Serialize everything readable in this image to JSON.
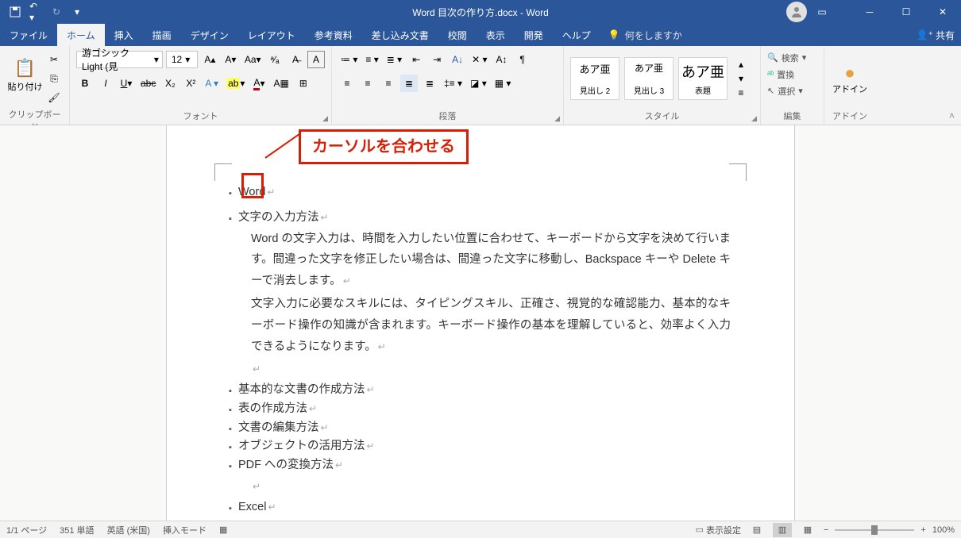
{
  "title": "Word  目次の作り方.docx  -  Word",
  "menutabs": [
    "ファイル",
    "ホーム",
    "挿入",
    "描画",
    "デザイン",
    "レイアウト",
    "参考資料",
    "差し込み文書",
    "校閲",
    "表示",
    "開発",
    "ヘルプ"
  ],
  "active_tab": 1,
  "tellme": "何をしますか",
  "share": "共有",
  "clipboard": {
    "paste": "貼り付け",
    "label": "クリップボード"
  },
  "font": {
    "name": "游ゴシック Light (見",
    "size": "12",
    "label": "フォント"
  },
  "paragraph_label": "段落",
  "styles": {
    "label": "スタイル",
    "items": [
      {
        "sample": "あア亜",
        "name": "見出し 2"
      },
      {
        "sample": "あア亜",
        "name": "見出し 3"
      },
      {
        "sample": "あア亜",
        "name": "表題"
      }
    ]
  },
  "editing": {
    "find": "検索",
    "replace": "置換",
    "select": "選択",
    "label": "編集"
  },
  "addins": {
    "label": "アドイン",
    "btn": "アドイン"
  },
  "callout": "カーソルを合わせる",
  "doc": {
    "h_word": "Word",
    "h_input": "文字の入力方法",
    "p1": "Word の文字入力は、時間を入力したい位置に合わせて、キーボードから文字を決めて行います。間違った文字を修正したい場合は、間違った文字に移動し、Backspace キーや Delete キーで消去します。",
    "p2": "文字入力に必要なスキルには、タイピングスキル、正確さ、視覚的な確認能力、基本的なキーボード操作の知識が含まれます。キーボード操作の基本を理解していると、効率よく入力できるようになります。",
    "h_basic": "基本的な文書の作成方法",
    "h_table": "表の作成方法",
    "h_edit": "文書の編集方法",
    "h_obj": "オブジェクトの活用方法",
    "h_pdf": "PDF への変換方法",
    "h_excel": "Excel"
  },
  "status": {
    "page": "1/1 ページ",
    "words": "351 単語",
    "lang": "英語 (米国)",
    "mode": "挿入モード",
    "focus": "表示設定",
    "zoom": "100%"
  }
}
